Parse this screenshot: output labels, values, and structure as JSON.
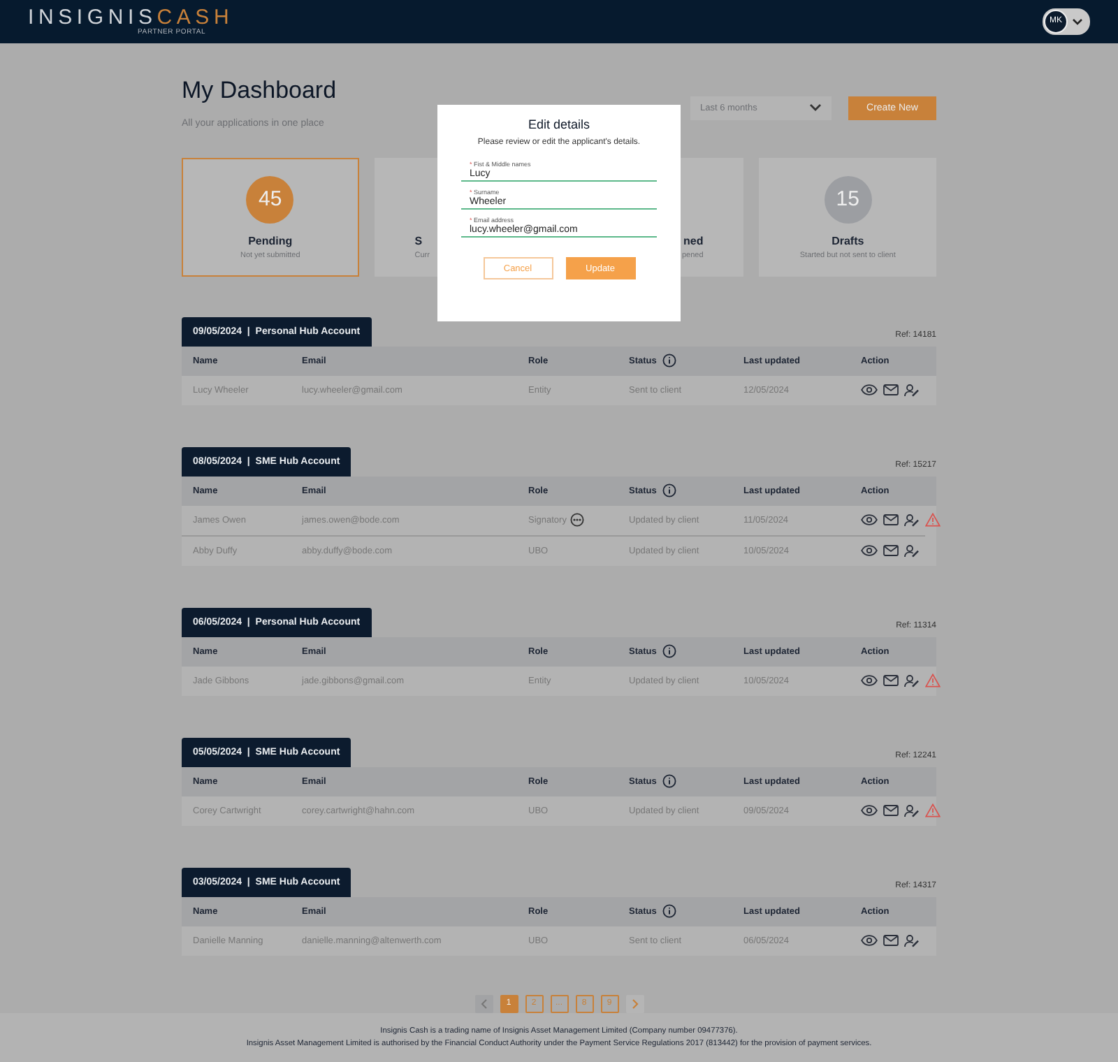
{
  "header": {
    "logo_a": "INSIGNIS",
    "logo_b": "CASH",
    "logo_sub": "PARTNER PORTAL",
    "avatar": "MK"
  },
  "page": {
    "title": "My Dashboard",
    "subtitle": "All your applications in one place",
    "period": "Last 6 months",
    "create_button": "Create New"
  },
  "stats": [
    {
      "kind": "full",
      "count": "45",
      "title": "Pending",
      "subtitle": "Not yet submitted",
      "color": "#c8813a",
      "selected": true
    },
    {
      "kind": "cut-end",
      "title": "S",
      "subtitle": "Curr",
      "selected": false
    },
    {
      "kind": "cut-start",
      "title": "ned",
      "subtitle": "pened",
      "selected": false
    },
    {
      "kind": "full",
      "count": "15",
      "title": "Drafts",
      "subtitle": "Started but not sent to client",
      "color": "#9c9ea2",
      "selected": false
    }
  ],
  "sections": [
    {
      "date": "09/05/2024",
      "separator": "|",
      "account": "Personal Hub Account",
      "ref": "Ref: 14181",
      "columns": [
        "Name",
        "Email",
        "Role",
        "Status",
        "Last updated",
        "Action"
      ],
      "rows": [
        {
          "name": "Lucy Wheeler",
          "email": "lucy.wheeler@gmail.com",
          "role": "Entity",
          "role_more": false,
          "status": "Sent to client",
          "last_updated": "12/05/2024",
          "warning": false
        }
      ]
    },
    {
      "date": "08/05/2024",
      "separator": "|",
      "account": "SME Hub Account",
      "ref": "Ref: 15217",
      "columns": [
        "Name",
        "Email",
        "Role",
        "Status",
        "Last updated",
        "Action"
      ],
      "rows": [
        {
          "name": "James Owen",
          "email": "james.owen@bode.com",
          "role": "Signatory",
          "role_more": true,
          "status": "Updated by client",
          "last_updated": "11/05/2024",
          "warning": true
        },
        {
          "name": "Abby Duffy",
          "email": "abby.duffy@bode.com",
          "role": "UBO",
          "role_more": false,
          "status": "Updated by client",
          "last_updated": "10/05/2024",
          "warning": false
        }
      ]
    },
    {
      "date": "06/05/2024",
      "separator": "|",
      "account": "Personal Hub Account",
      "ref": "Ref: 11314",
      "columns": [
        "Name",
        "Email",
        "Role",
        "Status",
        "Last updated",
        "Action"
      ],
      "rows": [
        {
          "name": "Jade Gibbons",
          "email": "jade.gibbons@gmail.com",
          "role": "Entity",
          "role_more": false,
          "status": "Updated by client",
          "last_updated": "10/05/2024",
          "warning": true
        }
      ]
    },
    {
      "date": "05/05/2024",
      "separator": "|",
      "account": "SME Hub Account",
      "ref": "Ref: 12241",
      "columns": [
        "Name",
        "Email",
        "Role",
        "Status",
        "Last updated",
        "Action"
      ],
      "rows": [
        {
          "name": "Corey Cartwright",
          "email": "corey.cartwright@hahn.com",
          "role": "UBO",
          "role_more": false,
          "status": "Updated by client",
          "last_updated": "09/05/2024",
          "warning": true
        }
      ]
    },
    {
      "date": "03/05/2024",
      "separator": "|",
      "account": "SME Hub Account",
      "ref": "Ref: 14317",
      "columns": [
        "Name",
        "Email",
        "Role",
        "Status",
        "Last updated",
        "Action"
      ],
      "rows": [
        {
          "name": "Danielle Manning",
          "email": "danielle.manning@altenwerth.com",
          "role": "UBO",
          "role_more": false,
          "status": "Sent to client",
          "last_updated": "06/05/2024",
          "warning": false
        }
      ]
    }
  ],
  "pagination": {
    "prev_disabled": true,
    "pages": [
      {
        "label": "1",
        "selected": true
      },
      {
        "label": "2",
        "selected": false
      },
      {
        "label": "...",
        "selected": false
      },
      {
        "label": "8",
        "selected": false
      },
      {
        "label": "9",
        "selected": false
      }
    ]
  },
  "modal": {
    "title": "Edit details",
    "required_mark": "*",
    "text": "Please review or edit the applicant's details.",
    "fields": [
      {
        "label": "Fist & Middle names",
        "value": "Lucy",
        "required": true
      },
      {
        "label": "Surname",
        "value": "Wheeler",
        "required": true
      },
      {
        "label": "Email address",
        "value": "lucy.wheeler@gmail.com",
        "required": true
      }
    ],
    "cancel": "Cancel",
    "update": "Update"
  },
  "footer": [
    "Insignis Cash is a trading name of Insignis Asset Management Limited (Company number 09477376).",
    "Insignis Asset Management Limited is authorised by the Financial Conduct Authority under the Payment Service Regulations 2017 (813442) for the provision of payment services."
  ]
}
